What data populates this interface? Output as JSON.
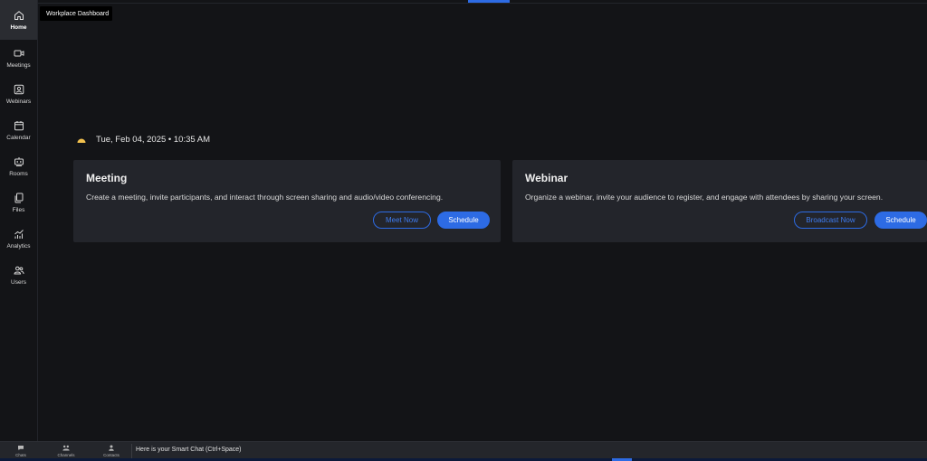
{
  "sidebar": {
    "items": [
      {
        "label": "Home",
        "icon": "home-icon"
      },
      {
        "label": "Meetings",
        "icon": "video-camera-icon"
      },
      {
        "label": "Webinars",
        "icon": "webinar-icon"
      },
      {
        "label": "Calendar",
        "icon": "calendar-icon"
      },
      {
        "label": "Rooms",
        "icon": "rooms-icon"
      },
      {
        "label": "Files",
        "icon": "files-icon"
      },
      {
        "label": "Analytics",
        "icon": "analytics-icon"
      },
      {
        "label": "Users",
        "icon": "users-icon"
      }
    ],
    "active": "Home"
  },
  "tooltip": {
    "text": "Workplace Dashboard"
  },
  "dateline": {
    "text": "Tue, Feb 04, 2025 • 10:35 AM",
    "icon": "sun-icon"
  },
  "cards": {
    "meeting": {
      "title": "Meeting",
      "description": "Create a meeting, invite participants, and interact through screen sharing and audio/video conferencing.",
      "secondary_button": "Meet Now",
      "primary_button": "Schedule"
    },
    "webinar": {
      "title": "Webinar",
      "description": "Organize a webinar, invite your audience to register, and engage with attendees by sharing your screen.",
      "secondary_button": "Broadcast Now",
      "primary_button": "Schedule"
    }
  },
  "bottombar": {
    "items": [
      {
        "label": "Chats",
        "icon": "chat-icon"
      },
      {
        "label": "Channels",
        "icon": "channels-icon"
      },
      {
        "label": "Contacts",
        "icon": "contacts-icon"
      }
    ],
    "smart_chat": "Here is your Smart Chat (Ctrl+Space)"
  },
  "colors": {
    "background": "#131417",
    "card": "#23252b",
    "accent": "#2d6be4",
    "sun": "#f2c14e"
  }
}
